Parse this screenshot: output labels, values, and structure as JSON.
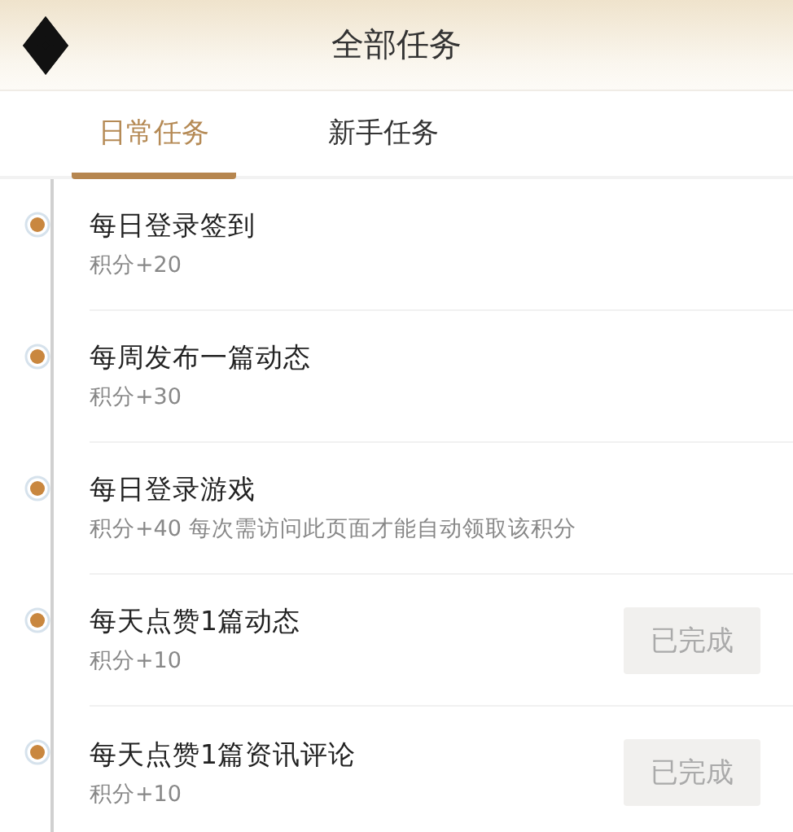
{
  "header": {
    "title": "全部任务"
  },
  "tabs": [
    {
      "label": "日常任务",
      "selected": true
    },
    {
      "label": "新手任务",
      "selected": false
    }
  ],
  "tasks": [
    {
      "title": "每日登录签到",
      "detail": "积分+20"
    },
    {
      "title": "每周发布一篇动态",
      "detail": "积分+30"
    },
    {
      "title": "每日登录游戏",
      "detail": "积分+40 每次需访问此页面才能自动领取该积分"
    },
    {
      "title": "每天点赞1篇动态",
      "detail": "积分+10",
      "button": {
        "label": "已完成",
        "disabled": true
      }
    },
    {
      "title": "每天点赞1篇资讯评论",
      "detail": "积分+10",
      "button": {
        "label": "已完成",
        "disabled": true
      }
    }
  ]
}
